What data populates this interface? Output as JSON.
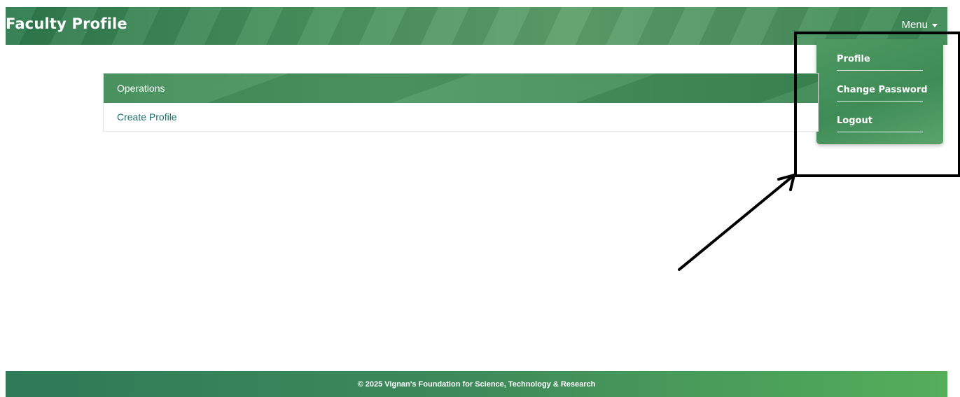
{
  "header": {
    "title": "Faculty Profile",
    "menu_label": "Menu"
  },
  "dropdown": {
    "items": [
      {
        "label": "Profile"
      },
      {
        "label": "Change Password"
      },
      {
        "label": "Logout"
      }
    ]
  },
  "card": {
    "header": "Operations",
    "link": "Create Profile"
  },
  "footer": {
    "text": "© 2025 Vignan's Foundation for Science, Technology & Research"
  },
  "colors": {
    "brand_green": "#3f8a57",
    "link_teal": "#1f6d6d",
    "annotation": "#000000"
  },
  "icons": {
    "menu_caret": "chevron-down-icon"
  }
}
